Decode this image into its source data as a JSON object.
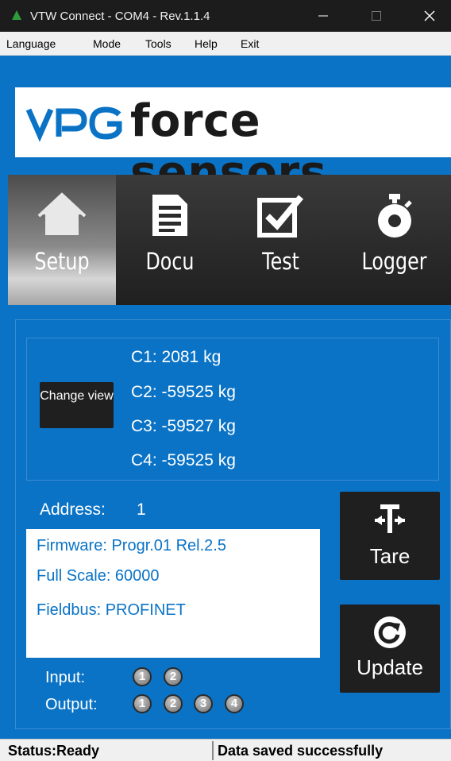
{
  "window": {
    "title": "VTW Connect - COM4 - Rev.1.1.4"
  },
  "menu": {
    "items": [
      "Language",
      "Mode",
      "Tools",
      "Help",
      "Exit"
    ]
  },
  "logo": {
    "brand": "VPG",
    "tagline": "force sensors"
  },
  "nav": {
    "tabs": [
      {
        "label": "Setup",
        "icon": "home-icon",
        "active": true
      },
      {
        "label": "Docu",
        "icon": "document-icon",
        "active": false
      },
      {
        "label": "Test",
        "icon": "checkbox-icon",
        "active": false
      },
      {
        "label": "Logger",
        "icon": "stopwatch-icon",
        "active": false
      }
    ]
  },
  "readings": {
    "change_view_label": "Change view",
    "channels": [
      "C1: 2081 kg",
      "C2: -59525 kg",
      "C3: -59527 kg",
      "C4: -59525 kg"
    ]
  },
  "device": {
    "address_label": "Address:",
    "address_value": "1",
    "info": [
      "Firmware: Progr.01 Rel.2.5",
      "Full Scale: 60000",
      "Fieldbus: PROFINET"
    ]
  },
  "actions": {
    "tare_label": "Tare",
    "update_label": "Update"
  },
  "io": {
    "input_label": "Input:",
    "inputs": [
      "1",
      "2"
    ],
    "output_label": "Output:",
    "outputs": [
      "1",
      "2",
      "3",
      "4"
    ]
  },
  "status": {
    "left": "Status:Ready",
    "right": "Data saved successfully"
  },
  "colors": {
    "background": "#0a73c6",
    "brand_blue": "#0a73c6",
    "button_dark": "#1f1f1f"
  }
}
